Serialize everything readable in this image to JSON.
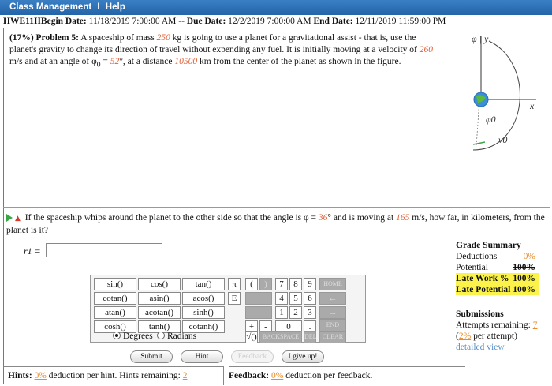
{
  "menu": {
    "class_mgmt": "Class Management",
    "sep": "I",
    "help": "Help"
  },
  "hw": {
    "name": "HWE11IIBegin Date:",
    "begin": "11/18/2019 7:00:00 AM",
    "due_sep": "-- Due Date:",
    "due": "12/2/2019 7:00:00 AM",
    "end_lbl": "End Date:",
    "end": "12/11/2019 11:59:00 PM"
  },
  "problem": {
    "header": "(17%) Problem 5:",
    "t1": "A spaceship of mass",
    "mass": "250",
    "t2": "kg is going to use a planet for a gravitational assist - that is, use the planet's gravity to change its direction of travel without expending any fuel. It is initially moving at a velocity of",
    "v0": "260",
    "t3": "m/s and at an angle of φ",
    "t3b": "0",
    "t3c": "=",
    "angle0": "52",
    "t4": "°, at a distance",
    "dist": "10500",
    "t5": "km from the center of the planet as shown in the figure."
  },
  "figure": {
    "phi_y": "φ | y",
    "x": "x",
    "phi0": "φ0",
    "v0": "v0"
  },
  "question": {
    "t1": "If the spaceship whips around the planet to the other side so that the angle is φ =",
    "angle": "36",
    "t2": "° and is moving at",
    "speed": "165",
    "t3": "m/s, how far, in kilometers, from the planet is it?",
    "answer_label": "r1 =",
    "answer_value": ""
  },
  "calculator": {
    "funcs": [
      [
        "sin()",
        "cos()",
        "tan()"
      ],
      [
        "cotan()",
        "asin()",
        "acos()"
      ],
      [
        "atan()",
        "acotan()",
        "sinh()"
      ],
      [
        "cosh()",
        "tanh()",
        "cotanh()"
      ]
    ],
    "pi": "π",
    "e": "E",
    "lparen": "(",
    "rparen": ")",
    "digits": [
      [
        "7",
        "8",
        "9"
      ],
      [
        "4",
        "5",
        "6"
      ],
      [
        "1",
        "2",
        "3"
      ]
    ],
    "zero": "0",
    "dot": ".",
    "plus": "+",
    "minus": "-",
    "sqrt": "√()",
    "home": "HOME",
    "back_arrow": "←",
    "fwd_arrow": "→",
    "end": "END",
    "backspace": "BACKSPACE",
    "del": "DEL",
    "clear": "CLEAR",
    "degrees": "Degrees",
    "radians": "Radians",
    "mode": "degrees"
  },
  "buttons": {
    "submit": "Submit",
    "hint": "Hint",
    "feedback": "Feedback",
    "giveup": "I give up!"
  },
  "grade": {
    "title": "Grade Summary",
    "deductions_lbl": "Deductions",
    "deductions": "0%",
    "potential_lbl": "Potential",
    "potential": "100%",
    "late_work_lbl": "Late Work %",
    "late_work": "100%",
    "late_potential_lbl": "Late Potential",
    "late_potential": "100%"
  },
  "submissions": {
    "title": "Submissions",
    "remaining_lbl": "Attempts remaining:",
    "remaining": "7",
    "per_attempt": "2%",
    "per_attempt_lbl": "per attempt)",
    "detailed": "detailed view"
  },
  "hints": {
    "lbl": "Hints:",
    "pct": "0%",
    "t1": "deduction per hint. Hints remaining:",
    "remaining": "2"
  },
  "feedback": {
    "lbl": "Feedback:",
    "pct": "0%",
    "t1": "deduction per feedback."
  },
  "colors": {
    "accent": "#2a6db5",
    "highlight": "#fbf24a",
    "red_value": "#e0633c"
  }
}
